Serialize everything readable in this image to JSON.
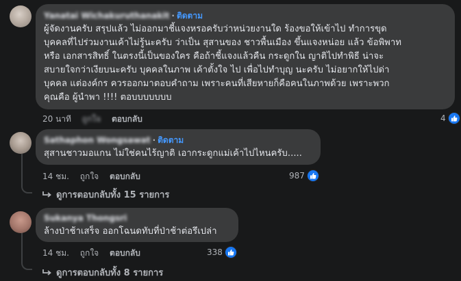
{
  "comments": [
    {
      "author": "Yanatai Wichakuruthanakit",
      "follow_label": "ติดตาม",
      "text": "ผู้จัดงานครับ สรุปแล้ว ไม่ออกมาชี้แจงหรอครับว่าหน่วยงานใด ร้องขอให้เข้าไป ทำการขุด\nบุคคลที่ไปร่วมงานเค้าไม่รู้นะครับ ว่าเป็น สุสานของ ชาวพื้นเมือง ขึ้นแจงหน่อย แล้ว ข้อพิพาท\nหรือ เอกสารสิทธิ์ ในตรงนี้เป็นของใคร คือถ้าชี้แจงแล้วคืน กระดูกใน ญาติไปทำพิธี น่าจะ\nสบายใจกว่าเงียบนะครับ บุคคลในภาพ เค้าตั้งใจ ไป เพื่อไปทำบุญ นะครับ ไม่อยากให้ไปด่า\nบุคคล แต่องค์กร ควรออกมาตอบคำถาม เพราะคนที่เสียหายก็คือคนในภาพด้วย เพราะพวก\nคุณคือ ผู้นำพา !!!! ตอบบบบบบบ",
      "time": "20 นาที",
      "like_label": "ถูกใจ",
      "reply_label": "ตอบกลับ",
      "reaction_count": "4"
    },
    {
      "author": "Sathaphon Wongsawat",
      "follow_label": "ติดตาม",
      "text": "สุสานชาวมอแกน ไม่ใช่คนไร้ญาติ เอากระดูกแม่เค้าไปไหนครับ.....",
      "time": "14 ชม.",
      "like_label": "ถูกใจ",
      "reply_label": "ตอบกลับ",
      "reaction_count": "987",
      "view_replies": "ดูการตอบกลับทั้ง 15 รายการ"
    },
    {
      "author": "Sukanya Thongsri",
      "text": "ล้างป่าช้าเสร็จ ออกโฉนดทับที่ป่าช้าต่อรึเปล่า",
      "time": "14 ชม.",
      "like_label": "ถูกใจ",
      "reply_label": "ตอบกลับ",
      "reaction_count": "338",
      "view_replies": "ดูการตอบกลับทั้ง 8 รายการ"
    }
  ],
  "icons": {
    "like": "like-icon",
    "reply_arrow": "reply-arrow-icon"
  },
  "colors": {
    "background": "#18191a",
    "bubble": "#3a3b3c",
    "follow": "#4599ff",
    "like_badge": "#1877f2"
  }
}
